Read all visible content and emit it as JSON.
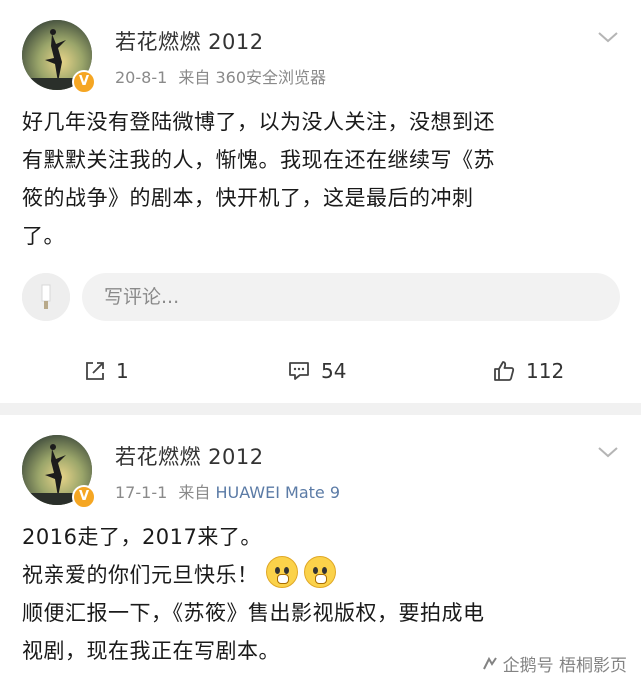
{
  "posts": [
    {
      "username": "若花燃燃 2012",
      "date": "20-8-1",
      "source_prefix": "来自",
      "source": "360安全浏览器",
      "content_lines": [
        "好几年没有登陆微博了，以为没人关注，没想到还",
        "有默默关注我的人，惭愧。我现在还在继续写《苏",
        "筱的战争》的剧本，快开机了，这是最后的冲刺",
        "了。"
      ],
      "comment_placeholder": "写评论...",
      "repost_count": "1",
      "comment_count": "54",
      "like_count": "112"
    },
    {
      "username": "若花燃燃 2012",
      "date": "17-1-1",
      "source_prefix": "来自",
      "source": "HUAWEI Mate 9",
      "content_lines": [
        "2016走了，2017来了。",
        "祝亲爱的你们元旦快乐！",
        "顺便汇报一下，《苏筱》售出影视版权，要拍成电",
        "视剧，现在我正在写剧本。"
      ]
    }
  ],
  "icons": {
    "verified": "verified-v-badge",
    "chevron": "chevron-down-icon",
    "repost": "repost-icon",
    "comment": "comment-icon",
    "like": "thumbs-up-icon",
    "emoji": "scared-face-emoji"
  },
  "colors": {
    "verified_badge": "#f5a623",
    "device_link": "#5b7ba6",
    "meta_gray": "#8a8a8a"
  },
  "watermark": {
    "text": "企鹅号 梧桐影页"
  }
}
